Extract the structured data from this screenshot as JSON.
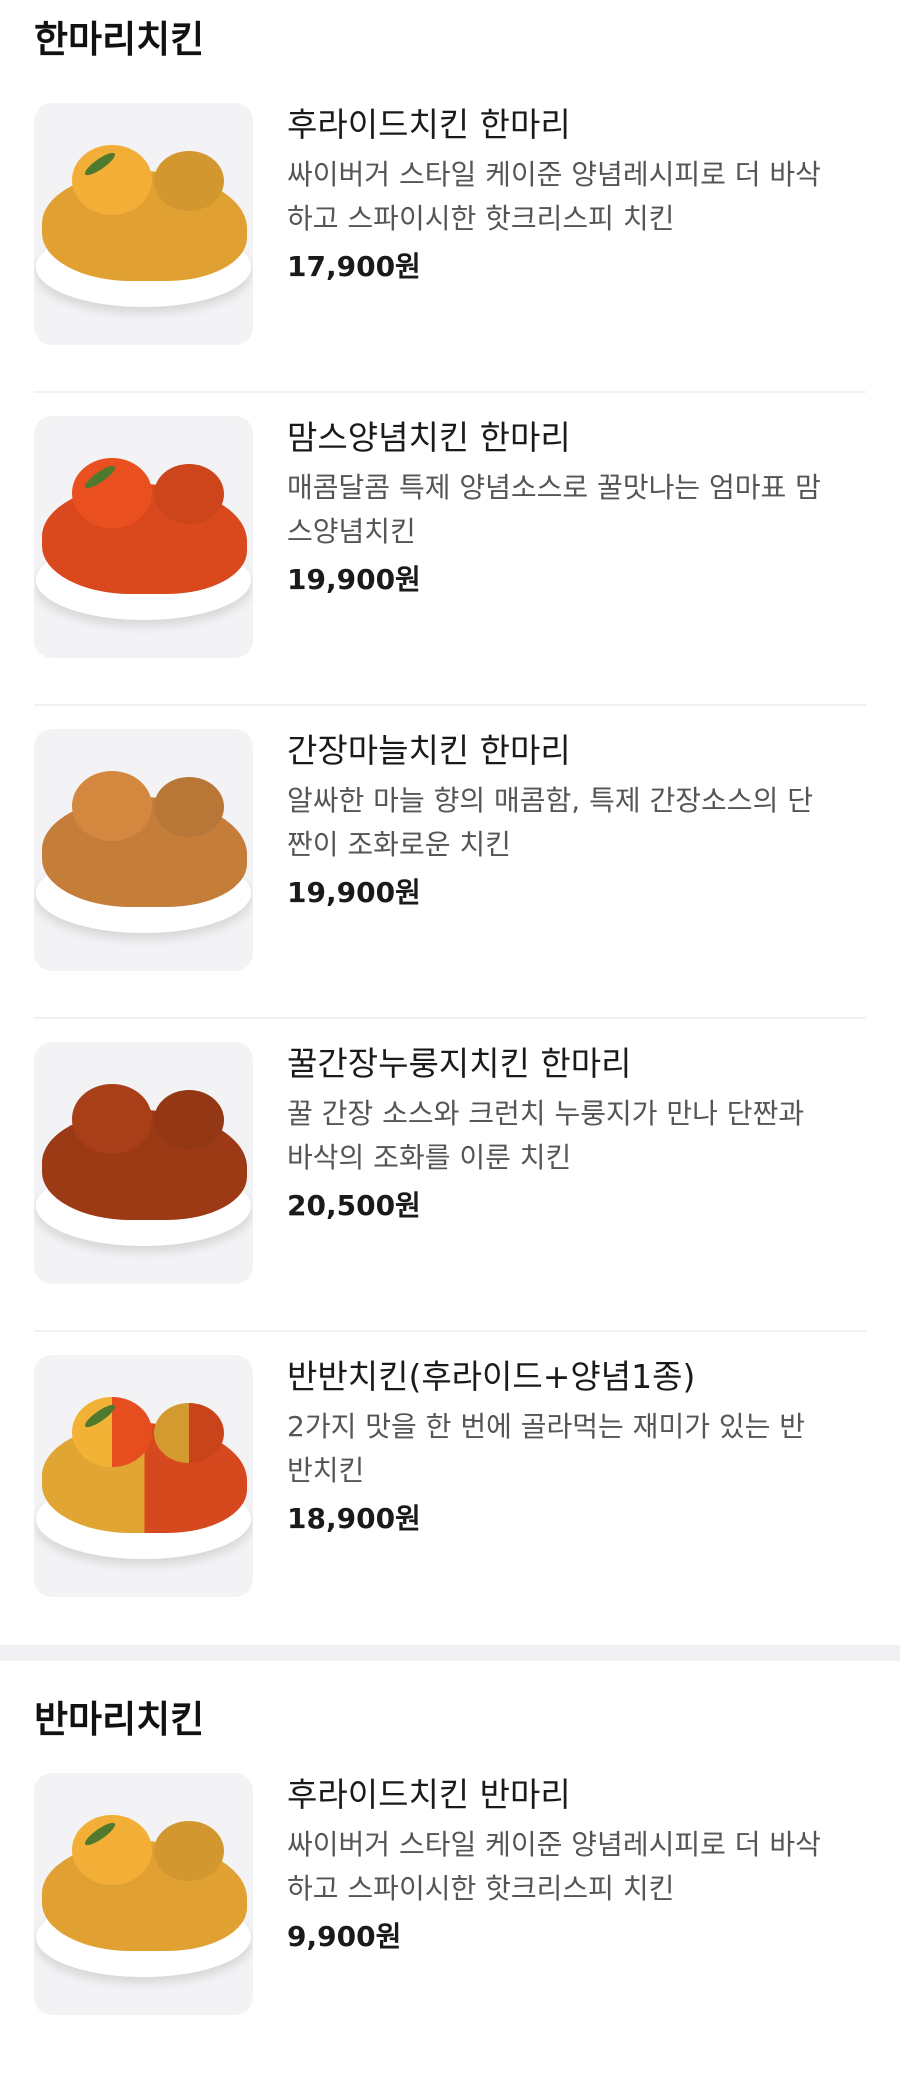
{
  "sections": [
    {
      "title": "한마리치킨",
      "items": [
        {
          "name": "후라이드치킨 한마리",
          "desc_line1": "싸이버거 스타일 케이준 양념레시피로 더 바삭",
          "desc_line2": "하고 스파이시한 핫크리스피 치킨",
          "price": "17,900원",
          "image": "fried-chicken-image"
        },
        {
          "name": "맘스양념치킨 한마리",
          "desc_line1": "매콤달콤 특제 양념소스로 꿀맛나는 엄마표 맘",
          "desc_line2": "스양념치킨",
          "price": "19,900원",
          "image": "sauce-chicken-image"
        },
        {
          "name": "간장마늘치킨 한마리",
          "desc_line1": "알싸한 마늘 향의 매콤함, 특제 간장소스의 단",
          "desc_line2": "짠이 조화로운 치킨",
          "price": "19,900원",
          "image": "garlic-chicken-image"
        },
        {
          "name": "꿀간장누룽지치킨 한마리",
          "desc_line1": "꿀 간장 소스와 크런치 누룽지가 만나 단짠과",
          "desc_line2": "바삭의 조화를 이룬 치킨",
          "price": "20,500원",
          "image": "honey-soy-chicken-image"
        },
        {
          "name": "반반치킨(후라이드+양념1종)",
          "desc_line1": "2가지 맛을 한 번에 골라먹는 재미가 있는 반",
          "desc_line2": "반치킨",
          "price": "18,900원",
          "image": "half-half-chicken-image"
        }
      ]
    },
    {
      "title": "반마리치킨",
      "items": [
        {
          "name": "후라이드치킨 반마리",
          "desc_line1": "싸이버거 스타일 케이준 양념레시피로 더 바삭",
          "desc_line2": "하고 스파이시한 핫크리스피 치킨",
          "price": "9,900원",
          "image": "fried-chicken-image"
        }
      ]
    }
  ]
}
